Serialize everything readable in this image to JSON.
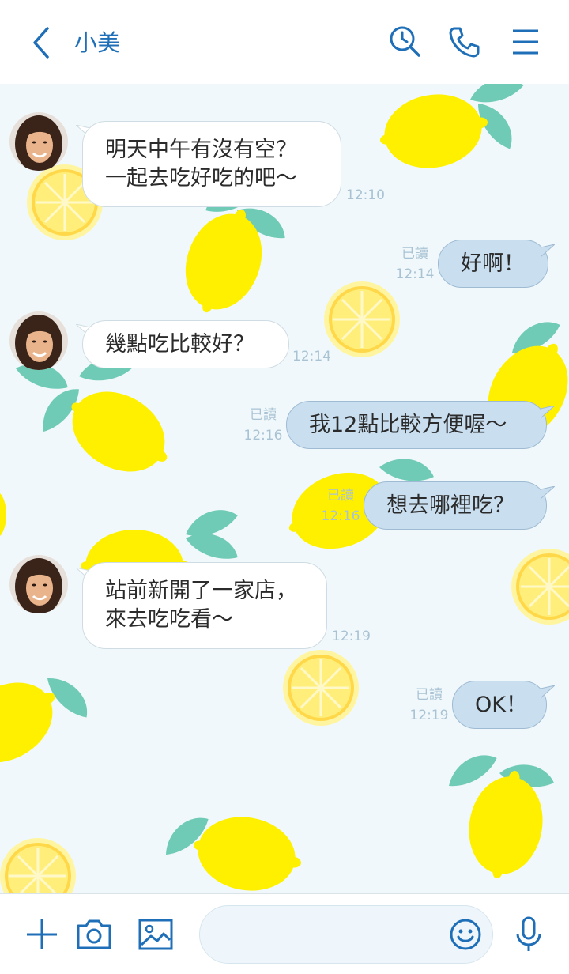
{
  "header": {
    "contact_name": "小美"
  },
  "messages": [
    {
      "side": "in",
      "lines": [
        "明天中午有沒有空？",
        "一起去吃好吃的吧～"
      ],
      "time": "12:10"
    },
    {
      "side": "out",
      "lines": [
        "好啊！"
      ],
      "read": "已讀",
      "time": "12:14"
    },
    {
      "side": "in",
      "lines": [
        "幾點吃比較好？"
      ],
      "time": "12:14"
    },
    {
      "side": "out",
      "lines": [
        "我12點比較方便喔～"
      ],
      "read": "已讀",
      "time": "12:16"
    },
    {
      "side": "out",
      "lines": [
        "想去哪裡吃？"
      ],
      "read": "已讀",
      "time": "12:16"
    },
    {
      "side": "in",
      "lines": [
        "站前新開了一家店，",
        "來去吃吃看～"
      ],
      "time": "12:19"
    },
    {
      "side": "out",
      "lines": [
        "OK！"
      ],
      "read": "已讀",
      "time": "12:19"
    }
  ],
  "input": {
    "placeholder": ""
  },
  "colors": {
    "accent": "#1f6fb8",
    "chat_background": "#f0f8fb",
    "outgoing_bubble": "#c9dff0",
    "incoming_bubble": "#ffffff",
    "lemon": "#fff000",
    "leaf": "#6fcbb5"
  },
  "icons": [
    "back-icon",
    "search-history-icon",
    "phone-icon",
    "menu-icon",
    "plus-icon",
    "camera-icon",
    "image-icon",
    "emoji-icon",
    "microphone-icon"
  ]
}
